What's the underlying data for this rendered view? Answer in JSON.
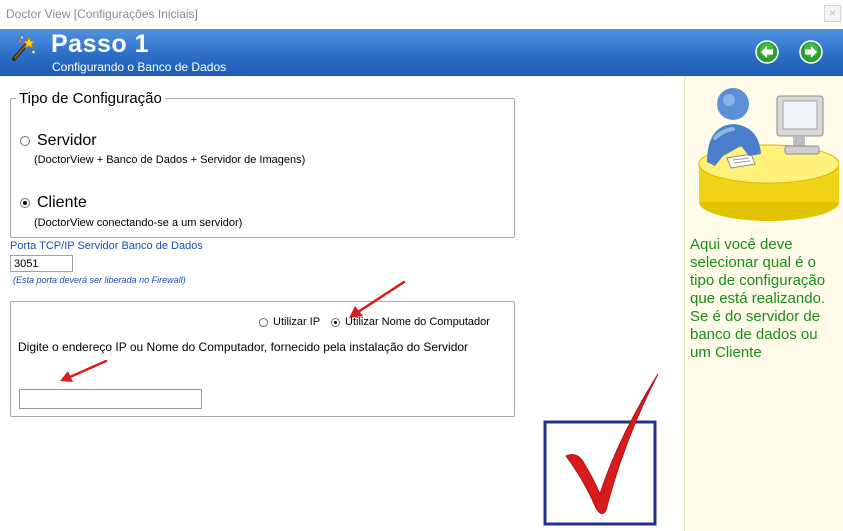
{
  "window": {
    "title": "Doctor View [Configurações Iniciais]",
    "close_symbol": "×"
  },
  "header": {
    "title": "Passo 1",
    "subtitle": "Configurando o Banco de Dados",
    "back_icon": "arrow-left-icon",
    "forward_icon": "arrow-right-icon"
  },
  "config_type": {
    "legend": "Tipo de Configuração",
    "options": [
      {
        "label": "Servidor",
        "description": "(DoctorView + Banco de Dados + Servidor de Imagens)",
        "selected": false
      },
      {
        "label": "Cliente",
        "description": "(DoctorView conectando-se a um servidor)",
        "selected": true
      }
    ]
  },
  "port": {
    "label": "Porta TCP/IP Servidor Banco de Dados",
    "value": "3051",
    "note": "(Esta porta deverá ser liberada no Firewall)"
  },
  "address": {
    "options": [
      {
        "label": "Utilizar IP",
        "selected": false
      },
      {
        "label": "Utilizar Nome do Computador",
        "selected": true
      }
    ],
    "description": "Digite o endereço IP ou Nome do Computador, fornecido pela instalação do Servidor",
    "value": ""
  },
  "help": {
    "text": "Aqui você deve selecionar qual é o tipo de configuração que está realizando. Se é do servidor de banco de dados ou um Cliente"
  },
  "colors": {
    "header_blue": "#2d6fc8",
    "help_bg": "#fffdea",
    "help_text": "#1a8a1a",
    "link_blue": "#1a4fb0",
    "nav_green": "#2e9e2e",
    "check_red": "#d81b1b",
    "check_frame": "#22328c"
  }
}
